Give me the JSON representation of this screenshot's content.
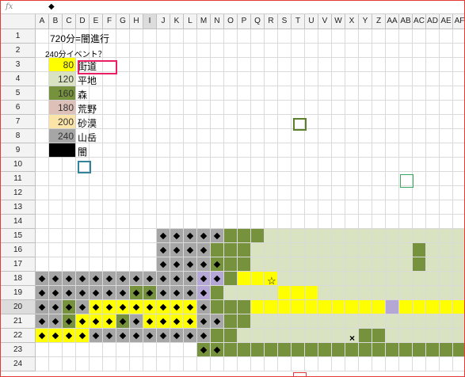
{
  "formula_bar": {
    "fx_icon": "fx",
    "value": "◆"
  },
  "columns": [
    "A",
    "B",
    "C",
    "D",
    "E",
    "F",
    "G",
    "H",
    "I",
    "J",
    "K",
    "L",
    "M",
    "N",
    "O",
    "P",
    "Q",
    "R",
    "S",
    "T",
    "U",
    "V",
    "W",
    "X",
    "Y",
    "Z",
    "AA",
    "AB",
    "AC",
    "AD",
    "AE",
    "AF"
  ],
  "selected_column": "I",
  "rows": [
    "1",
    "2",
    "3",
    "4",
    "5",
    "6",
    "7",
    "8",
    "9",
    "10",
    "11",
    "12",
    "13",
    "14",
    "15",
    "16",
    "17",
    "18",
    "19",
    "20",
    "21",
    "22",
    "23",
    "24"
  ],
  "selected_row": "20",
  "header_text": {
    "title": "720分=闇進行",
    "subtitle": "240分イベント？"
  },
  "legend": [
    {
      "value": "80",
      "label": "街道",
      "color": "#ffff00"
    },
    {
      "value": "120",
      "label": "平地",
      "color": "#d9e3c1"
    },
    {
      "value": "160",
      "label": "森",
      "color": "#76923c"
    },
    {
      "value": "180",
      "label": "荒野",
      "color": "#dfc0b8"
    },
    {
      "value": "200",
      "label": "砂漠",
      "color": "#fce4a8"
    },
    {
      "value": "240",
      "label": "山岳",
      "color": "#a6a6a6"
    },
    {
      "value": "",
      "label": "闇",
      "color": "#000000"
    }
  ],
  "map_marks": {
    "star": "☆",
    "circle": "○",
    "cross": "×"
  },
  "colors": {
    "road": "#ffff00",
    "plain": "#d9e3c1",
    "forest": "#76923c",
    "mountain": "#a6a6a6",
    "purple": "#b4a7d6",
    "pink_border": "#e91e63",
    "teal_border": "#31849b",
    "olive_border": "#5b7f2b",
    "green_border": "#38a85c",
    "red": "#e53935"
  },
  "map": {
    "rows": [
      {
        "r": 15,
        "spans": [
          [
            "M",
            9,
            13
          ],
          [
            "F",
            14,
            16
          ],
          [
            "P",
            17,
            31
          ]
        ],
        "diamonds": [
          9,
          10,
          11,
          12,
          13
        ]
      },
      {
        "r": 16,
        "spans": [
          [
            "M",
            9,
            12
          ],
          [
            "F",
            13,
            15
          ],
          [
            "P",
            16,
            27
          ],
          [
            "F",
            28,
            28
          ],
          [
            "P",
            29,
            31
          ]
        ],
        "diamonds": [
          9,
          10,
          11,
          12
        ]
      },
      {
        "r": 17,
        "spans": [
          [
            "M",
            9,
            12
          ],
          [
            "F",
            13,
            15
          ],
          [
            "P",
            16,
            28
          ],
          [
            "F",
            28,
            28
          ],
          [
            "P",
            29,
            31
          ]
        ],
        "diamonds": [
          9,
          10,
          11,
          12,
          13
        ]
      },
      {
        "r": 18,
        "spans": [
          [
            "M",
            0,
            11
          ],
          [
            "V",
            12,
            13
          ],
          [
            "F",
            14,
            14
          ],
          [
            "Y",
            15,
            17
          ],
          [
            "P",
            18,
            31
          ]
        ],
        "diamonds": [
          0,
          1,
          2,
          3,
          4,
          5,
          6,
          7,
          8,
          9,
          10,
          11,
          12,
          13
        ]
      },
      {
        "r": 19,
        "spans": [
          [
            "M",
            0,
            6
          ],
          [
            "F",
            7,
            8
          ],
          [
            "M",
            9,
            11
          ],
          [
            "V",
            12,
            12
          ],
          [
            "F",
            13,
            13
          ],
          [
            "P",
            14,
            17
          ],
          [
            "Y",
            18,
            20
          ],
          [
            "P",
            21,
            31
          ]
        ],
        "diamonds": [
          0,
          1,
          2,
          3,
          4,
          5,
          6,
          7,
          8,
          9,
          10,
          11,
          12
        ]
      },
      {
        "r": 20,
        "spans": [
          [
            "M",
            0,
            1
          ],
          [
            "F",
            2,
            2
          ],
          [
            "M",
            3,
            3
          ],
          [
            "Y",
            4,
            11
          ],
          [
            "M",
            12,
            12
          ],
          [
            "F",
            13,
            15
          ],
          [
            "Y",
            16,
            25
          ],
          [
            "V",
            26,
            26
          ],
          [
            "Y",
            27,
            31
          ]
        ],
        "diamonds": [
          0,
          1,
          2,
          3,
          4,
          5,
          6,
          7,
          8,
          9,
          10,
          11,
          12
        ]
      },
      {
        "r": 21,
        "spans": [
          [
            "M",
            0,
            1
          ],
          [
            "F",
            2,
            2
          ],
          [
            "Y",
            3,
            5
          ],
          [
            "F",
            6,
            6
          ],
          [
            "M",
            7,
            7
          ],
          [
            "Y",
            8,
            11
          ],
          [
            "M",
            12,
            13
          ],
          [
            "F",
            14,
            15
          ],
          [
            "P",
            16,
            31
          ]
        ],
        "diamonds": [
          0,
          1,
          2,
          3,
          4,
          5,
          6,
          7,
          8,
          9,
          10,
          11,
          12,
          13
        ]
      },
      {
        "r": 22,
        "spans": [
          [
            "Y",
            0,
            3
          ],
          [
            "M",
            4,
            12
          ],
          [
            "F",
            13,
            14
          ],
          [
            "P",
            15,
            23
          ],
          [
            "F",
            24,
            25
          ],
          [
            "P",
            26,
            31
          ]
        ],
        "diamonds": [
          0,
          1,
          2,
          3,
          4,
          5,
          6,
          7,
          8,
          9,
          10,
          11,
          12
        ]
      },
      {
        "r": 23,
        "spans": [
          [
            "F",
            12,
            31
          ]
        ],
        "diamonds": [
          12,
          13
        ]
      }
    ]
  }
}
